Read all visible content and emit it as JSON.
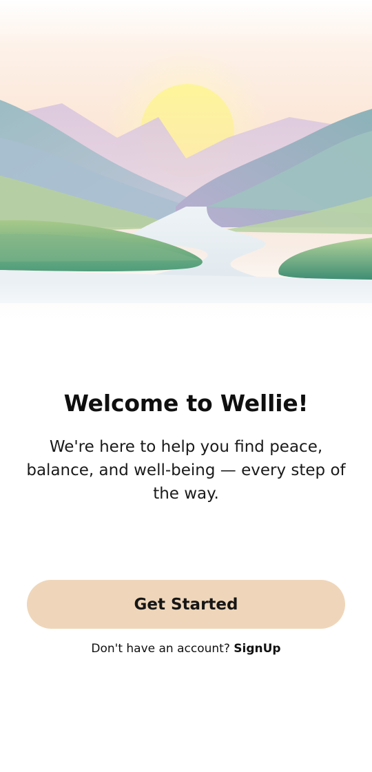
{
  "hero": {
    "illustration": "mountain-valley-sunrise-river"
  },
  "welcome": {
    "title": "Welcome to Wellie!",
    "subtitle": "We're here to help you find peace, balance, and well-being — every step of the way."
  },
  "cta": {
    "label": "Get Started"
  },
  "signup": {
    "prompt": "Don't have an account?",
    "link": "SignUp"
  },
  "colors": {
    "button_bg": "#efd6ba",
    "text": "#111111",
    "background": "#ffffff"
  }
}
